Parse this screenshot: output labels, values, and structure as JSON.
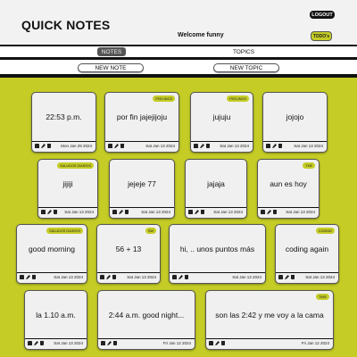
{
  "header": {
    "title": "QUICK NOTES",
    "logout": "LOGOUT",
    "welcome": "Welcome funny",
    "todo": "TODO's"
  },
  "tabs": [
    {
      "label": "NOTES",
      "active": true
    },
    {
      "label": "TOPICS",
      "active": false
    }
  ],
  "actions": {
    "new_note": "NEW NOTE",
    "new_topic": "NEW TOPIC"
  },
  "colors": {
    "accent": "#c5cc26",
    "dark": "#111111",
    "card": "#f0f0f0"
  },
  "notes": [
    {
      "text": "22:53 p.m.",
      "tag": "",
      "date": "Mon Jan 29 2024"
    },
    {
      "text": "por fin jajejijoju",
      "tag": "FEELINGS",
      "date": "Sat Jan 13 2024"
    },
    {
      "text": "jujuju",
      "tag": "FEELINGS",
      "date": "Sat Jan 13 2024"
    },
    {
      "text": "jojojo",
      "tag": "",
      "date": "Sat Jan 13 2024"
    },
    {
      "text": "jijiji",
      "tag": "SALUDOS DIARIOS",
      "date": "Sat Jan 13 2024"
    },
    {
      "text": "jejeje 77",
      "tag": "",
      "date": "Sat Jan 13 2024"
    },
    {
      "text": "jajaja",
      "tag": "",
      "date": "Sat Jan 13 2024"
    },
    {
      "text": "aun es hoy",
      "tag": "THE",
      "date": "Sat Jan 13 2024"
    },
    {
      "text": "good morning",
      "tag": "SALUDOS DIARIOS",
      "date": "Sat Jan 13 2024"
    },
    {
      "text": "56 + 13",
      "tag": "SW",
      "date": "Sat Jan 13 2024"
    },
    {
      "text": "hi, .. unos puntos más",
      "tag": "",
      "date": "Sat Jan 13 2024"
    },
    {
      "text": "coding again",
      "tag": "CODING",
      "date": "Sat Jan 13 2024"
    },
    {
      "text": "la 1.10 a.m.",
      "tag": "",
      "date": "Sat Jan 13 2024"
    },
    {
      "text": "2:44 a.m. good night...",
      "tag": "",
      "date": "Fri Jan 12 2024"
    },
    {
      "text": "son las 2:42 y me voy a la cama",
      "tag": "TIME",
      "date": "Fri Jan 12 2024"
    }
  ]
}
